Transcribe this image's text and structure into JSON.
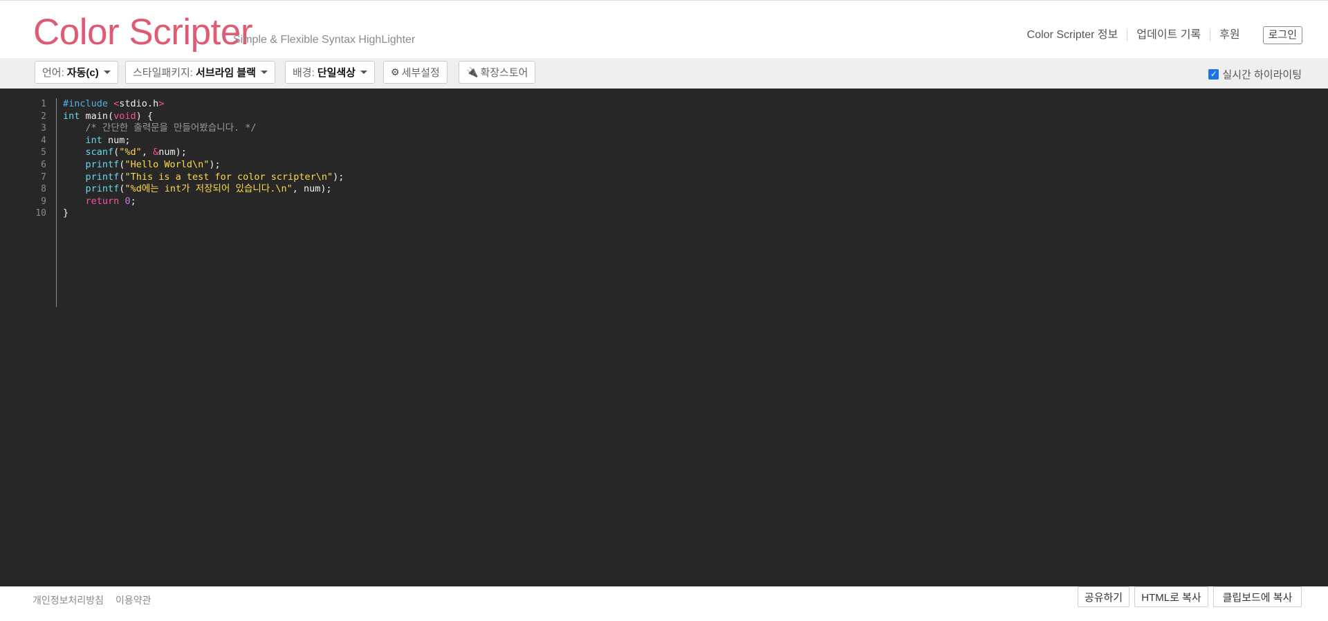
{
  "header": {
    "logo": "Color Scripter",
    "tagline": "Simple & Flexible Syntax HighLighter",
    "nav": [
      "Color Scripter 정보",
      "업데이트 기록",
      "후원"
    ],
    "login": "로그인"
  },
  "toolbar": {
    "language": {
      "label": "언어:",
      "value": "자동(c)"
    },
    "style": {
      "label": "스타일패키지:",
      "value": "서브라임 블랙"
    },
    "background": {
      "label": "배경:",
      "value": "단일색상"
    },
    "settings": "세부설정",
    "store": "확장스토어",
    "realtime": "실시간 하이라이팅"
  },
  "editor": {
    "line_numbers": [
      "1",
      "2",
      "3",
      "4",
      "5",
      "6",
      "7",
      "8",
      "9",
      "10"
    ],
    "lines": [
      [
        {
          "c": "t-preproc",
          "t": "#include "
        },
        {
          "c": "t-kw",
          "t": "<"
        },
        {
          "c": "t-plain",
          "t": "stdio.h"
        },
        {
          "c": "t-kw",
          "t": ">"
        }
      ],
      [
        {
          "c": "t-type",
          "t": "int"
        },
        {
          "c": "t-plain",
          "t": " main("
        },
        {
          "c": "t-kw",
          "t": "void"
        },
        {
          "c": "t-plain",
          "t": ") {"
        }
      ],
      [
        {
          "c": "t-comment",
          "t": "    /* 간단한 출력문을 만들어봤습니다. */"
        }
      ],
      [
        {
          "c": "t-plain",
          "t": "    "
        },
        {
          "c": "t-type",
          "t": "int"
        },
        {
          "c": "t-plain",
          "t": " num;"
        }
      ],
      [
        {
          "c": "t-plain",
          "t": "    "
        },
        {
          "c": "t-fn",
          "t": "scanf"
        },
        {
          "c": "t-plain",
          "t": "("
        },
        {
          "c": "t-str",
          "t": "\"%d\""
        },
        {
          "c": "t-plain",
          "t": ", "
        },
        {
          "c": "t-kw",
          "t": "&"
        },
        {
          "c": "t-plain",
          "t": "num);"
        }
      ],
      [
        {
          "c": "t-plain",
          "t": "    "
        },
        {
          "c": "t-fn",
          "t": "printf"
        },
        {
          "c": "t-plain",
          "t": "("
        },
        {
          "c": "t-str",
          "t": "\"Hello World\\n\""
        },
        {
          "c": "t-plain",
          "t": ");"
        }
      ],
      [
        {
          "c": "t-plain",
          "t": "    "
        },
        {
          "c": "t-fn",
          "t": "printf"
        },
        {
          "c": "t-plain",
          "t": "("
        },
        {
          "c": "t-str",
          "t": "\"This is a test for color scripter\\n\""
        },
        {
          "c": "t-plain",
          "t": ");"
        }
      ],
      [
        {
          "c": "t-plain",
          "t": "    "
        },
        {
          "c": "t-fn",
          "t": "printf"
        },
        {
          "c": "t-plain",
          "t": "("
        },
        {
          "c": "t-str",
          "t": "\"%d에는 int가 저장되어 있습니다.\\n\""
        },
        {
          "c": "t-plain",
          "t": ", num);"
        }
      ],
      [
        {
          "c": "t-plain",
          "t": "    "
        },
        {
          "c": "t-kw",
          "t": "return"
        },
        {
          "c": "t-plain",
          "t": " "
        },
        {
          "c": "t-num",
          "t": "0"
        },
        {
          "c": "t-plain",
          "t": ";"
        }
      ],
      [
        {
          "c": "t-plain",
          "t": "}"
        }
      ]
    ]
  },
  "footer": {
    "privacy": "개인정보처리방침",
    "terms": "이용약관",
    "share": "공유하기",
    "copy_html": "HTML로 복사",
    "copy_clipboard": "클립보드에 복사"
  },
  "colors": {
    "logo": "#e05a74",
    "editor_bg": "#272727",
    "toolbar_bg": "#efefef"
  },
  "icons": {
    "settings": "gear-icon",
    "store": "plug-icon",
    "caret": "caret-down-icon"
  }
}
